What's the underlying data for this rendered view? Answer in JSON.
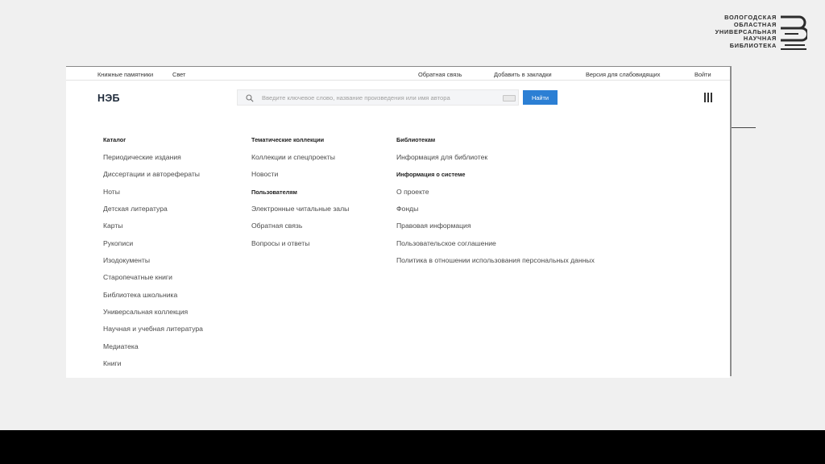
{
  "logo": {
    "lines": [
      "ВОЛОГОДСКАЯ",
      "ОБЛАСТНАЯ",
      "УНИВЕРСАЛЬНАЯ",
      "НАУЧНАЯ",
      "БИБЛИОТЕКА"
    ]
  },
  "topbar": {
    "left": [
      "Книжные памятники",
      "Свет"
    ],
    "feedback": "Обратная связь",
    "bookmarks": "Добавить в закладки",
    "accessible": "Версия для слабовидящих",
    "login": "Войти"
  },
  "header": {
    "brand": "НЭБ"
  },
  "search": {
    "placeholder": "Введите ключевое слово, название произведения или имя автора",
    "button": "Найти"
  },
  "columns": {
    "catalog": {
      "title": "Каталог",
      "items": [
        "Периодические издания",
        "Диссертации и авторефераты",
        "Ноты",
        "Детская литература",
        "Карты",
        "Рукописи",
        "Изодокументы",
        "Старопечатные книги",
        "Библиотека школьника",
        "Универсальная коллекция",
        "Научная и учебная литература",
        "Медиатека",
        "Книги"
      ]
    },
    "collections": {
      "title": "Тематические коллекции",
      "items": [
        "Коллекции и спецпроекты",
        "Новости"
      ],
      "users_title": "Пользователям",
      "users_items": [
        "Электронные читальные залы",
        "Обратная связь",
        "Вопросы и ответы"
      ]
    },
    "libraries": {
      "title": "Библиотекам",
      "items": [
        "Информация для библиотек"
      ],
      "system_title": "Информация о системе",
      "system_items": [
        "О проекте",
        "Фонды",
        "Правовая информация",
        "Пользовательское соглашение",
        "Политика в отношении использования персональных данных"
      ]
    }
  },
  "colors": {
    "accent": "#2b7fd4",
    "slide_bg": "#f0f0f0",
    "bar": "#000000"
  }
}
